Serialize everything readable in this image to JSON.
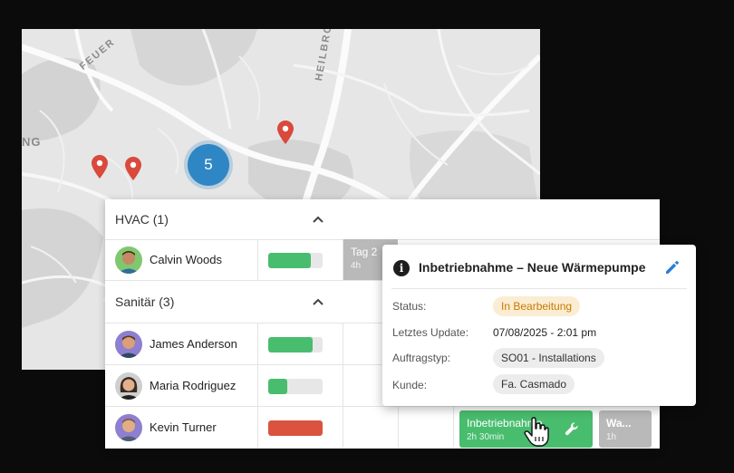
{
  "map": {
    "labels": {
      "feuer": "FEUER",
      "heilbronner": "HEILBRONNER",
      "ng": "NG"
    },
    "cluster_count": "5",
    "pin_color": "#d9493c",
    "cluster_color": "#2f86c4"
  },
  "scheduler": {
    "groups": [
      {
        "label": "HVAC (1)"
      },
      {
        "label": "Sanitär (3)"
      }
    ],
    "resources": [
      {
        "name": "Calvin Woods",
        "utilization": 0.78,
        "bar_color": "#49bd6e"
      },
      {
        "name": "James Anderson",
        "utilization": 0.82,
        "bar_color": "#49bd6e"
      },
      {
        "name": "Maria Rodriguez",
        "utilization": 0.35,
        "bar_color": "#49bd6e"
      },
      {
        "name": "Kevin Turner",
        "utilization": 1.0,
        "bar_color": "#d9533f"
      }
    ],
    "events": {
      "calvin_grey": {
        "title": "Tag 2",
        "duration": "4h"
      },
      "kevin_green": {
        "title": "Inbetriebnahme",
        "duration": "2h 30min"
      },
      "kevin_grey": {
        "title": "Wa...",
        "duration": "1h"
      }
    }
  },
  "popover": {
    "title": "Inbetriebnahme – Neue Wärmepumpe",
    "rows": {
      "status_key": "Status:",
      "status_val": "In Bearbeitung",
      "update_key": "Letztes Update:",
      "update_val": "07/08/2025 - 2:01 pm",
      "type_key": "Auftragstyp:",
      "type_val": "SO01 - Installations",
      "customer_key": "Kunde:",
      "customer_val": "Fa. Casmado"
    }
  },
  "colors": {
    "green": "#49bd6e",
    "grey_event": "#b9b9b9",
    "edit_icon": "#2a7fd4"
  }
}
